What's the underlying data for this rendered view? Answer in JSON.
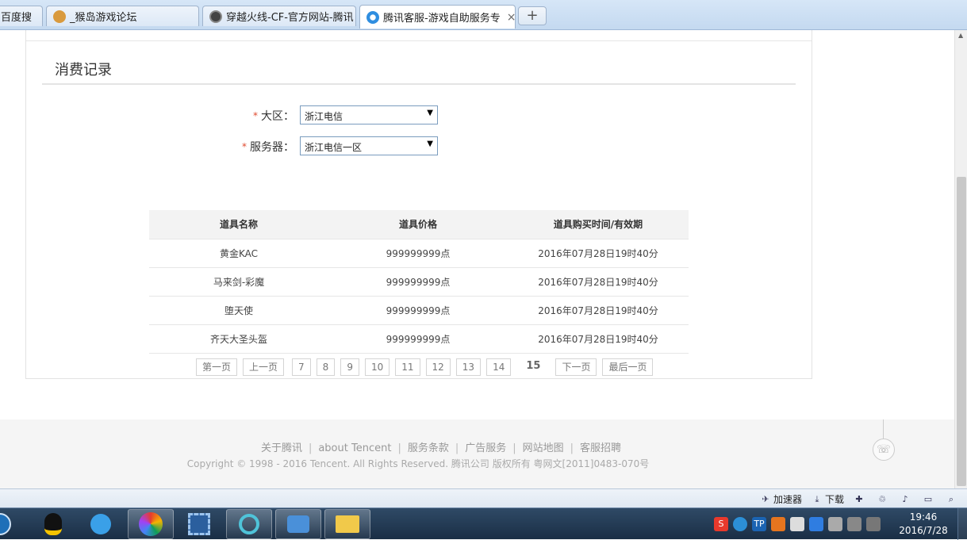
{
  "browser": {
    "tabs": [
      {
        "label": "百度搜",
        "icon": "baidu-icon"
      },
      {
        "label": "_猴岛游戏论坛",
        "icon": "monkey-icon"
      },
      {
        "label": "穿越火线-CF-官方网站-腾讯",
        "icon": "cf-icon"
      },
      {
        "label": "腾讯客服-游戏自助服务专",
        "icon": "ie-icon",
        "close": "×"
      }
    ],
    "new_tab_label": "+"
  },
  "page": {
    "section_title": "消费记录",
    "form": {
      "region_label": "大区：",
      "region_value": "浙江电信",
      "server_label": "服务器：",
      "server_value": "浙江电信一区",
      "required_mark": "*"
    },
    "table": {
      "headers": [
        "道具名称",
        "道具价格",
        "道具购买时间/有效期"
      ],
      "rows": [
        [
          "黄金KAC",
          "999999999点",
          "2016年07月28日19时40分"
        ],
        [
          "马来剑-彩魔",
          "999999999点",
          "2016年07月28日19时40分"
        ],
        [
          "堕天使",
          "999999999点",
          "2016年07月28日19时40分"
        ],
        [
          "齐天大圣头盔",
          "999999999点",
          "2016年07月28日19时40分"
        ]
      ]
    },
    "pager": {
      "first": "第一页",
      "prev": "上一页",
      "pages": [
        "7",
        "8",
        "9",
        "10",
        "11",
        "12",
        "13",
        "14"
      ],
      "current": "15",
      "next": "下一页",
      "last": "最后一页"
    }
  },
  "footer": {
    "links": [
      "关于腾讯",
      "about Tencent",
      "服务条款",
      "广告服务",
      "网站地图",
      "客服招聘"
    ],
    "separator": "|",
    "copyright": "Copyright © 1998 - 2016 Tencent. All Rights Reserved. 腾讯公司 版权所有 粤网文[2011]0483-070号"
  },
  "statusbar": {
    "accelerator": "加速器",
    "download": "下载"
  },
  "taskbar": {
    "time": "19:46",
    "date": "2016/7/28"
  }
}
